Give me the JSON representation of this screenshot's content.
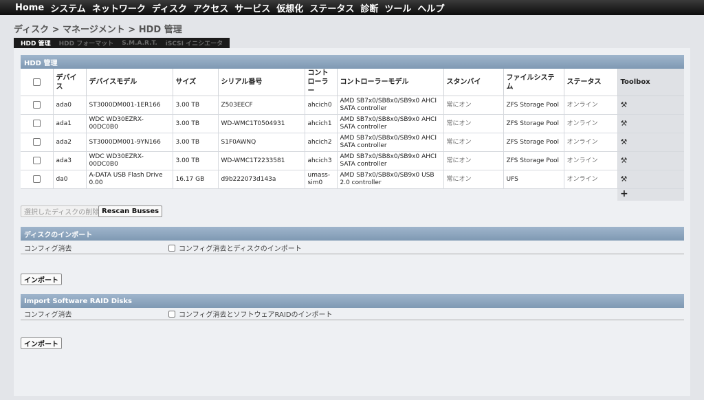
{
  "nav": {
    "items": [
      "Home",
      "システム",
      "ネットワーク",
      "ディスク",
      "アクセス",
      "サービス",
      "仮想化",
      "ステータス",
      "診断",
      "ツール",
      "ヘルプ"
    ]
  },
  "breadcrumb": "ディスク > マネージメント > HDD 管理",
  "tabs": [
    {
      "label": "HDD 管理",
      "active": true
    },
    {
      "label": "HDD フォーマット",
      "active": false
    },
    {
      "label": "S.M.A.R.T.",
      "active": false
    },
    {
      "label": "iSCSI イニシエータ",
      "active": false
    }
  ],
  "hdd_section": {
    "title": "HDD 管理",
    "columns": [
      "デバイス",
      "デバイスモデル",
      "サイズ",
      "シリアル番号",
      "コントローラー",
      "コントローラーモデル",
      "スタンバイ",
      "ファイルシステム",
      "ステータス",
      "Toolbox"
    ],
    "rows": [
      {
        "device": "ada0",
        "model": "ST3000DM001-1ER166",
        "size": "3.00 TB",
        "serial": "Z503EECF",
        "controller": "ahcich0",
        "controller_model": "AMD SB7x0/SB8x0/SB9x0 AHCI SATA controller",
        "standby": "常にオン",
        "filesystem": "ZFS Storage Pool",
        "status": "オンライン"
      },
      {
        "device": "ada1",
        "model": "WDC WD30EZRX-00DC0B0",
        "size": "3.00 TB",
        "serial": "WD-WMC1T0504931",
        "controller": "ahcich1",
        "controller_model": "AMD SB7x0/SB8x0/SB9x0 AHCI SATA controller",
        "standby": "常にオン",
        "filesystem": "ZFS Storage Pool",
        "status": "オンライン"
      },
      {
        "device": "ada2",
        "model": "ST3000DM001-9YN166",
        "size": "3.00 TB",
        "serial": "S1F0AWNQ",
        "controller": "ahcich2",
        "controller_model": "AMD SB7x0/SB8x0/SB9x0 AHCI SATA controller",
        "standby": "常にオン",
        "filesystem": "ZFS Storage Pool",
        "status": "オンライン"
      },
      {
        "device": "ada3",
        "model": "WDC WD30EZRX-00DC0B0",
        "size": "3.00 TB",
        "serial": "WD-WMC1T2233581",
        "controller": "ahcich3",
        "controller_model": "AMD SB7x0/SB8x0/SB9x0 AHCI SATA controller",
        "standby": "常にオン",
        "filesystem": "ZFS Storage Pool",
        "status": "オンライン"
      },
      {
        "device": "da0",
        "model": "A-DATA USB Flash Drive 0.00",
        "size": "16.17 GB",
        "serial": "d9b222073d143a",
        "controller": "umass-sim0",
        "controller_model": "AMD SB7x0/SB8x0/SB9x0 USB 2.0 controller",
        "standby": "常にオン",
        "filesystem": "UFS",
        "status": "オンライン"
      }
    ],
    "toolbox_icon": "tools-icon",
    "add_icon": "plus-icon"
  },
  "buttons": {
    "delete_selected": "選択したディスクの削除",
    "rescan": "Rescan Busses"
  },
  "import_section": {
    "title": "ディスクのインポート",
    "label": "コンフィグ消去",
    "checkbox_label": "コンフィグ消去とディスクのインポート",
    "button": "インポート"
  },
  "raid_section": {
    "title": "Import Software RAID Disks",
    "label": "コンフィグ消去",
    "checkbox_label": "コンフィグ消去とソフトウェアRAIDのインポート",
    "button": "インポート"
  }
}
